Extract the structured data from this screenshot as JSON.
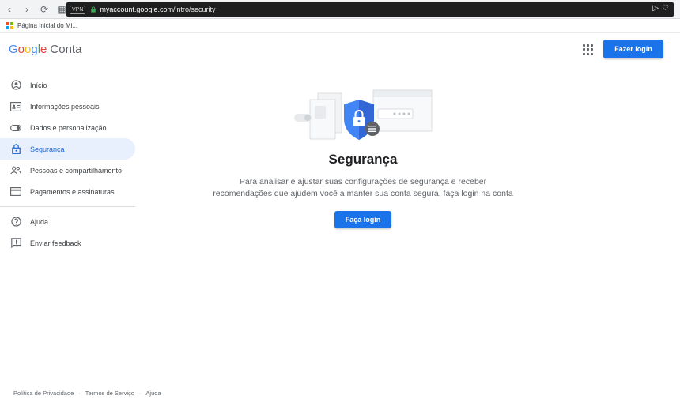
{
  "browser": {
    "back_icon": "‹",
    "forward_icon": "›",
    "reload_icon": "⟳",
    "grid_icon": "▦",
    "vpn_label": "VPN",
    "url_host": "myaccount.google.com",
    "url_path": "/intro/security",
    "send_icon": "▷",
    "heart_icon": "♡"
  },
  "bookmarks": {
    "item_label": "Página Inicial do Mi..."
  },
  "header": {
    "brand_word": "Google",
    "brand_suffix": "Conta",
    "login_label": "Fazer login"
  },
  "sidebar": {
    "items": [
      {
        "label": "Início",
        "icon": "account-circle-icon"
      },
      {
        "label": "Informações pessoais",
        "icon": "id-card-icon"
      },
      {
        "label": "Dados e personalização",
        "icon": "toggle-icon"
      },
      {
        "label": "Segurança",
        "icon": "lock-icon",
        "active": true
      },
      {
        "label": "Pessoas e compartilhamento",
        "icon": "people-icon"
      },
      {
        "label": "Pagamentos e assinaturas",
        "icon": "credit-card-icon"
      }
    ],
    "secondary": [
      {
        "label": "Ajuda",
        "icon": "help-icon"
      },
      {
        "label": "Enviar feedback",
        "icon": "feedback-icon"
      }
    ]
  },
  "main": {
    "title": "Segurança",
    "description_line1": "Para analisar e ajustar suas configurações de segurança e receber",
    "description_line2": "recomendações que ajudem você a manter sua conta segura, faça login na conta",
    "login_label": "Faça login"
  },
  "footer": {
    "privacy": "Política de Privacidade",
    "terms": "Termos de Serviço",
    "help": "Ajuda"
  },
  "colors": {
    "accent": "#1a73e8",
    "active_bg": "#e8f0fe",
    "active_text": "#1967d2"
  }
}
